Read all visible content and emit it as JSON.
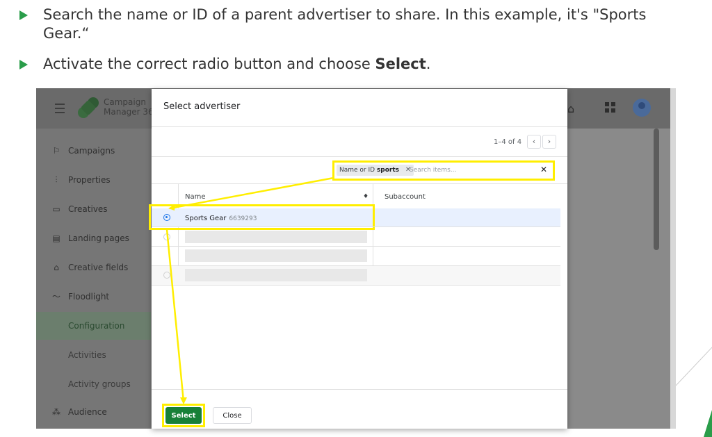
{
  "slide": {
    "bullet1": "Search the name or ID of a parent advertiser to share. In this example, it's \"Sports Gear.“",
    "bullet2_pre": "Activate the correct radio button and choose ",
    "bullet2_bold": "Select",
    "bullet2_post": "."
  },
  "app": {
    "name_line1": "Campaign",
    "name_line2": "Manager 360"
  },
  "sidebar": {
    "items": [
      {
        "label": "Campaigns",
        "icon": "campaigns-icon"
      },
      {
        "label": "Properties",
        "icon": "properties-icon"
      },
      {
        "label": "Creatives",
        "icon": "creatives-icon"
      },
      {
        "label": "Landing pages",
        "icon": "landing-pages-icon"
      },
      {
        "label": "Creative fields",
        "icon": "creative-fields-icon"
      },
      {
        "label": "Floodlight",
        "icon": "floodlight-icon"
      }
    ],
    "sub_items": [
      "Configuration",
      "Activities",
      "Activity groups"
    ],
    "active_sub": "Configuration",
    "audience": "Audience"
  },
  "dialog": {
    "title": "Select advertiser",
    "pager": "1–4 of 4",
    "filter": {
      "chip_label": "Name or ID",
      "chip_value": "sports",
      "search_placeholder": "Search items..."
    },
    "columns": [
      "Name",
      "Subaccount"
    ],
    "rows": [
      {
        "name": "Sports Gear",
        "id": "6639293",
        "selected": true
      }
    ],
    "buttons": {
      "select": "Select",
      "close": "Close"
    }
  },
  "colors": {
    "bullet_arrow": "#2a9d4a",
    "highlight": "#ffee00",
    "select_button": "#188038",
    "radio_selected": "#1a73e8"
  }
}
